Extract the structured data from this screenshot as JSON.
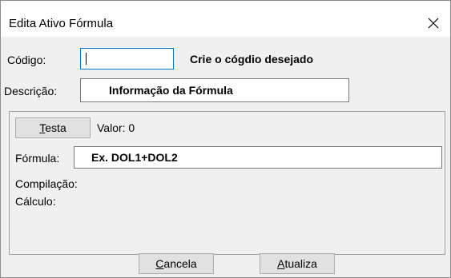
{
  "window": {
    "title": "Edita Ativo Fórmula",
    "close_icon": "close-icon"
  },
  "codigo": {
    "label": "Código:",
    "value": "",
    "hint": "Crie o cógdio desejado"
  },
  "descricao": {
    "label": "Descrição:",
    "value": "Informação da Fórmula"
  },
  "group": {
    "testa_button": {
      "mnemonic": "T",
      "rest": "esta"
    },
    "valor_label": "Valor: 0",
    "formula_label": "Fórmula:",
    "formula_value": "Ex. DOL1+DOL2",
    "compilacao_label": "Compilação:",
    "calculo_label": "Cálculo:"
  },
  "footer": {
    "cancela_button": {
      "mnemonic": "C",
      "rest": "ancela"
    },
    "atualiza_button": {
      "mnemonic": "A",
      "rest": "tualiza"
    }
  },
  "colors": {
    "focus_border": "#0078d7",
    "dialog_bg": "#f0f0f0",
    "button_bg": "#e1e1e1"
  }
}
